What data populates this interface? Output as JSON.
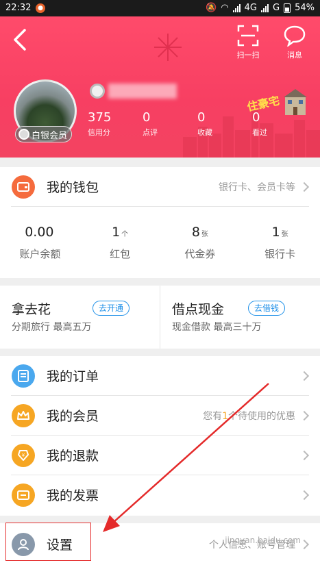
{
  "status_bar": {
    "time": "22:32",
    "network": "4G",
    "network2": "G",
    "battery": "54%"
  },
  "header": {
    "scan_label": "扫一扫",
    "message_label": "消息",
    "vip_label": "白银会员",
    "promo": "住豪宅",
    "stats": [
      {
        "value": "375",
        "label": "信用分"
      },
      {
        "value": "0",
        "label": "点评"
      },
      {
        "value": "0",
        "label": "收藏"
      },
      {
        "value": "0",
        "label": "看过"
      }
    ]
  },
  "wallet": {
    "title": "我的钱包",
    "hint": "银行卡、会员卡等",
    "items": [
      {
        "value": "0.00",
        "unit": "",
        "label": "账户余额"
      },
      {
        "value": "1",
        "unit": "个",
        "label": "红包"
      },
      {
        "value": "8",
        "unit": "张",
        "label": "代金券"
      },
      {
        "value": "1",
        "unit": "张",
        "label": "银行卡"
      }
    ]
  },
  "finance": {
    "left": {
      "title": "拿去花",
      "button": "去开通",
      "subtitle": "分期旅行 最高五万"
    },
    "right": {
      "title": "借点现金",
      "button": "去借钱",
      "subtitle": "现金借款 最高三十万"
    }
  },
  "menu": {
    "orders": {
      "title": "我的订单"
    },
    "membership": {
      "title": "我的会员",
      "hint_prefix": "您有",
      "hint_count": "1",
      "hint_suffix": "个待使用的优惠"
    },
    "refunds": {
      "title": "我的退款"
    },
    "invoices": {
      "title": "我的发票"
    }
  },
  "settings": {
    "title": "设置",
    "hint": "个人信息、账号管理"
  },
  "watermark": "jingyan.baidu.com",
  "colors": {
    "header": "#f73f62",
    "wallet_icon": "#f56b3d",
    "orders_icon": "#4aa8ee",
    "member_icon": "#f6a623",
    "refund_icon": "#f6a623",
    "invoice_icon": "#f6a623",
    "settings_icon": "#8898aa",
    "accent_blue": "#1e90e8",
    "annotation_red": "#e42a2a"
  }
}
